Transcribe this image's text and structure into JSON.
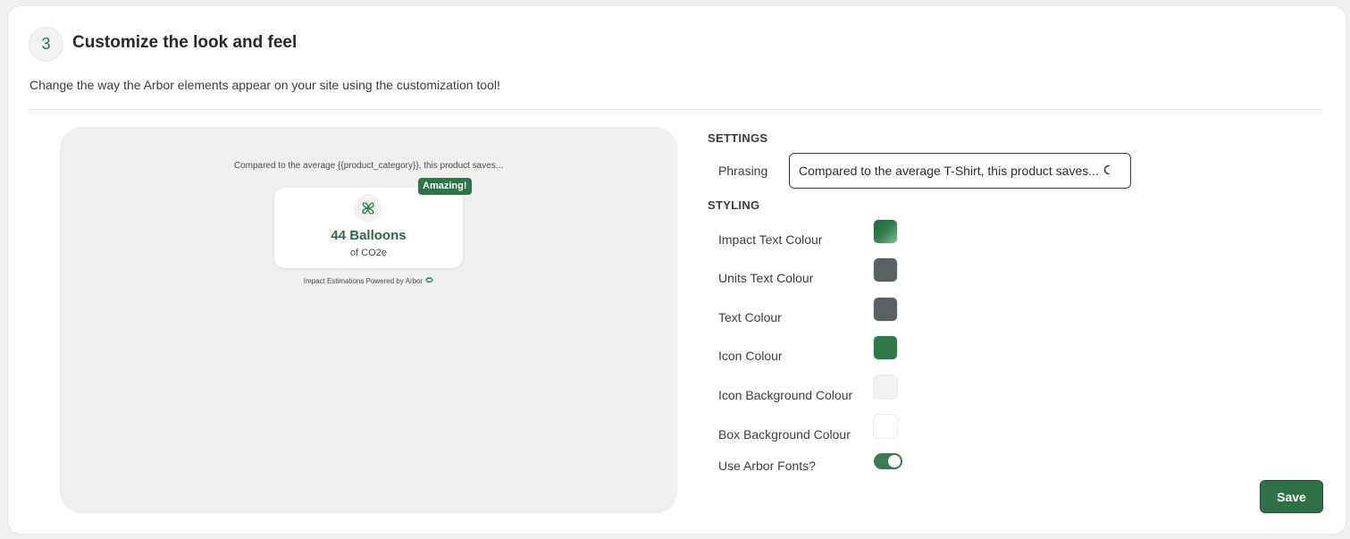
{
  "section": {
    "step_number": "3",
    "title": "Customize the look and feel",
    "description": "Change the way the Arbor elements appear on your site using the customization tool!"
  },
  "preview": {
    "phrase": "Compared to the average {{product_category}}, this product saves...",
    "badge": "Amazing!",
    "impact_value": "44 Balloons",
    "impact_unit": "of CO2e",
    "powered_by": "Impact Estimations Powered by Arbor",
    "icon": "pinwheel-icon"
  },
  "settings": {
    "heading": "SETTINGS",
    "phrasing_label": "Phrasing",
    "phrasing_value": "Compared to the average T-Shirt, this product saves..."
  },
  "styling": {
    "heading": "STYLING",
    "items": [
      {
        "label": "Impact Text Colour",
        "color": "#2e7a4a"
      },
      {
        "label": "Units Text Colour",
        "color": "#5a6162"
      },
      {
        "label": "Text Colour",
        "color": "#5a6162"
      },
      {
        "label": "Icon Colour",
        "color": "#2c7a47"
      },
      {
        "label": "Icon Background Colour",
        "color": "#f1f3f3"
      },
      {
        "label": "Box Background Colour",
        "color": "#ffffff"
      }
    ],
    "fonts_label": "Use Arbor Fonts?",
    "fonts_enabled": true
  },
  "actions": {
    "save_label": "Save"
  },
  "colors": {
    "brand_green": "#2e6b45",
    "preview_bg": "#eeefef"
  }
}
